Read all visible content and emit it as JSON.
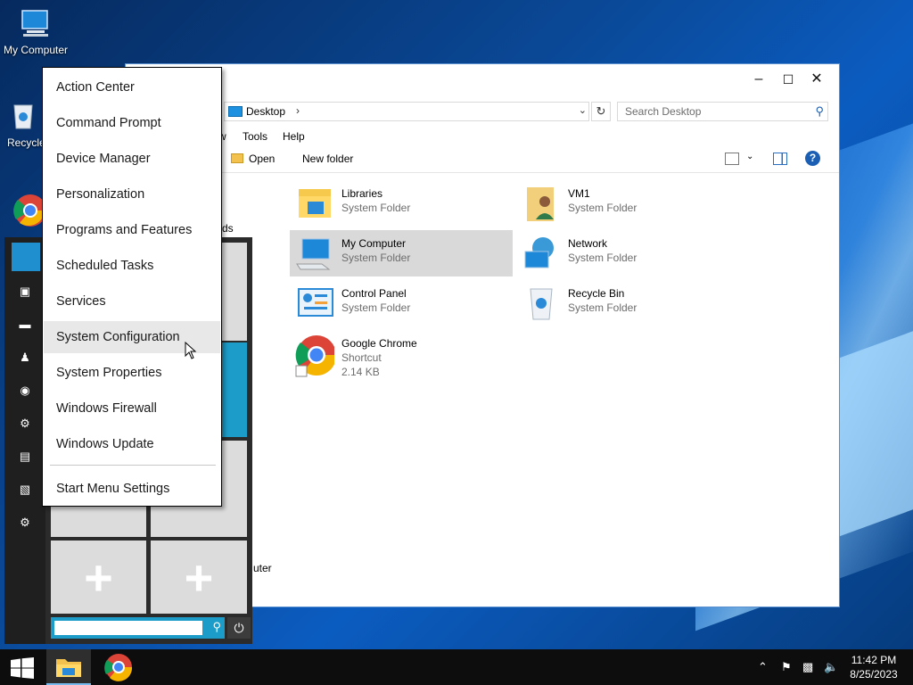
{
  "desktop": {
    "icons": [
      {
        "label": "My Computer"
      },
      {
        "label": "Recycle"
      }
    ]
  },
  "explorer": {
    "address": {
      "path": "Desktop"
    },
    "search_placeholder": "Search Desktop",
    "menu": [
      "w",
      "Tools",
      "Help"
    ],
    "toolbar": {
      "open": "Open",
      "new_folder": "New folder"
    },
    "nav_peek": [
      "ds",
      "uter"
    ],
    "items": [
      {
        "name": "Libraries",
        "sub": "System Folder"
      },
      {
        "name": "VM1",
        "sub": "System Folder"
      },
      {
        "name": "My Computer",
        "sub": "System Folder"
      },
      {
        "name": "Network",
        "sub": "System Folder"
      },
      {
        "name": "Control Panel",
        "sub": "System Folder"
      },
      {
        "name": "Recycle Bin",
        "sub": "System Folder"
      },
      {
        "name": "Google Chrome",
        "sub": "Shortcut",
        "size": "2.14 KB"
      }
    ]
  },
  "context_menu": {
    "items": [
      "Action Center",
      "Command Prompt",
      "Device Manager",
      "Personalization",
      "Programs and Features",
      "Scheduled Tasks",
      "Services",
      "System Configuration",
      "System Properties",
      "Windows Firewall",
      "Windows Update"
    ],
    "footer": "Start Menu Settings",
    "hovered": "System Configuration"
  },
  "taskbar": {
    "time": "11:42 PM",
    "date": "8/25/2023"
  },
  "colors": {
    "accent": "#1b9cc9",
    "taskbar": "#0d0d0d"
  }
}
